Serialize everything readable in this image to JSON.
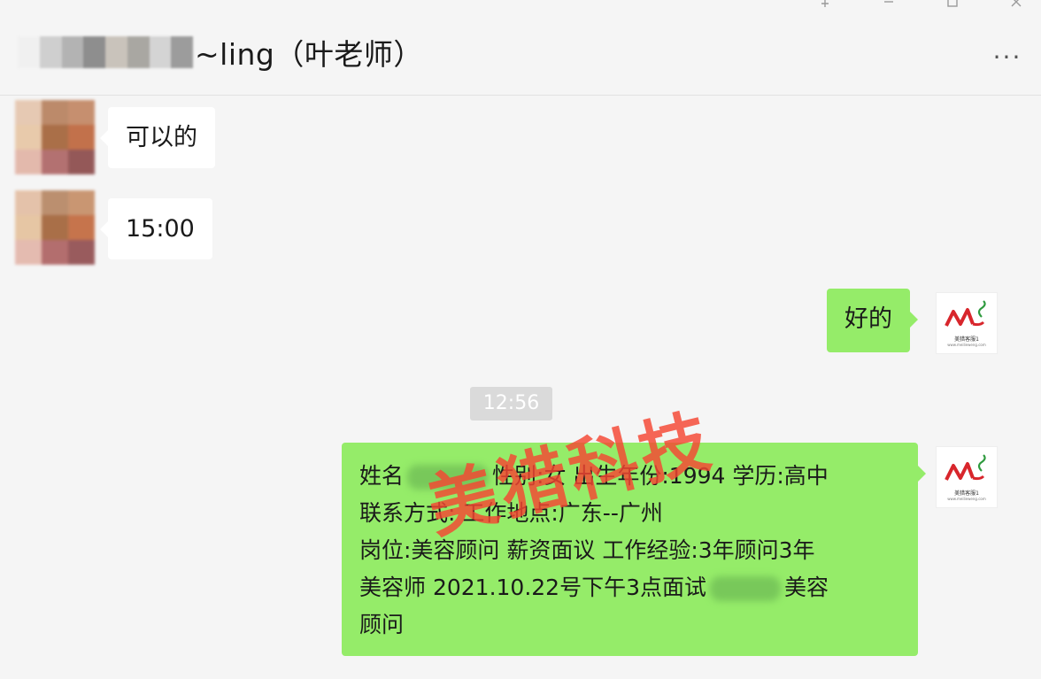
{
  "header": {
    "title_suffix": "~ling（叶老师）",
    "more_label": "···"
  },
  "messages": [
    {
      "direction": "in",
      "text": "可以的"
    },
    {
      "direction": "in",
      "text": "15:00"
    },
    {
      "direction": "out",
      "text": "好的"
    }
  ],
  "timestamp": "12:56",
  "long_message": {
    "line1_a": "姓名",
    "line1_b": "性别:女 出生年份:1994 学历:高中",
    "line2": "联系方式: 工作地点:广东--广州",
    "line3": "岗位:美容顾问 薪资面议 工作经验:3年顾问3年",
    "line4_a": "美容师 2021.10.22号下午3点面试",
    "line4_b": "美容",
    "line5": "顾问"
  },
  "watermark": "美猎科技",
  "logo": {
    "line1": "美猎客服1",
    "line2": "www.meilieweng.com"
  },
  "colors": {
    "outgoing_bubble": "#95ec69",
    "incoming_bubble": "#ffffff",
    "background": "#f5f5f5",
    "watermark": "#f54632"
  }
}
